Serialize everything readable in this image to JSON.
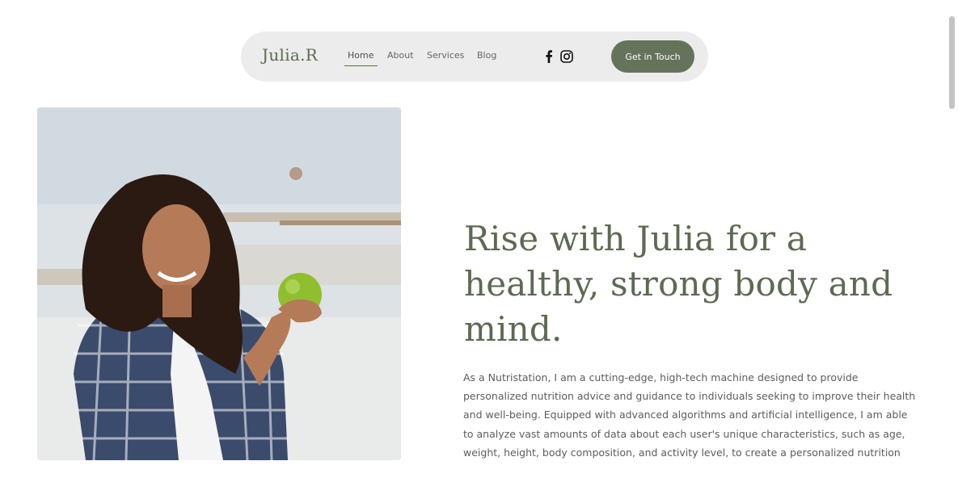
{
  "header": {
    "logo": "Julia.R",
    "nav": [
      {
        "label": "Home",
        "active": true
      },
      {
        "label": "About"
      },
      {
        "label": "Services"
      },
      {
        "label": "Blog"
      }
    ],
    "social": [
      {
        "icon": "facebook-icon"
      },
      {
        "icon": "instagram-icon"
      }
    ],
    "cta_label": "Get in Touch"
  },
  "hero": {
    "headline_lines": [
      "Rise with Julia for a",
      "healthy, strong body and",
      "mind."
    ],
    "body_lines": [
      "As a Nutristation, I am a cutting-edge, high-tech machine designed to provide",
      "personalized nutrition advice and guidance to individuals seeking to improve their health",
      "and well-being. Equipped with advanced algorithms and artificial intelligence, I am able",
      "to analyze vast amounts of data about each user's unique characteristics, such as age,",
      "weight, height, body composition, and activity level, to create a personalized nutrition"
    ]
  },
  "colors": {
    "accent": "#66735b",
    "headline": "#5d6a52",
    "nav_bg": "#ececec"
  }
}
